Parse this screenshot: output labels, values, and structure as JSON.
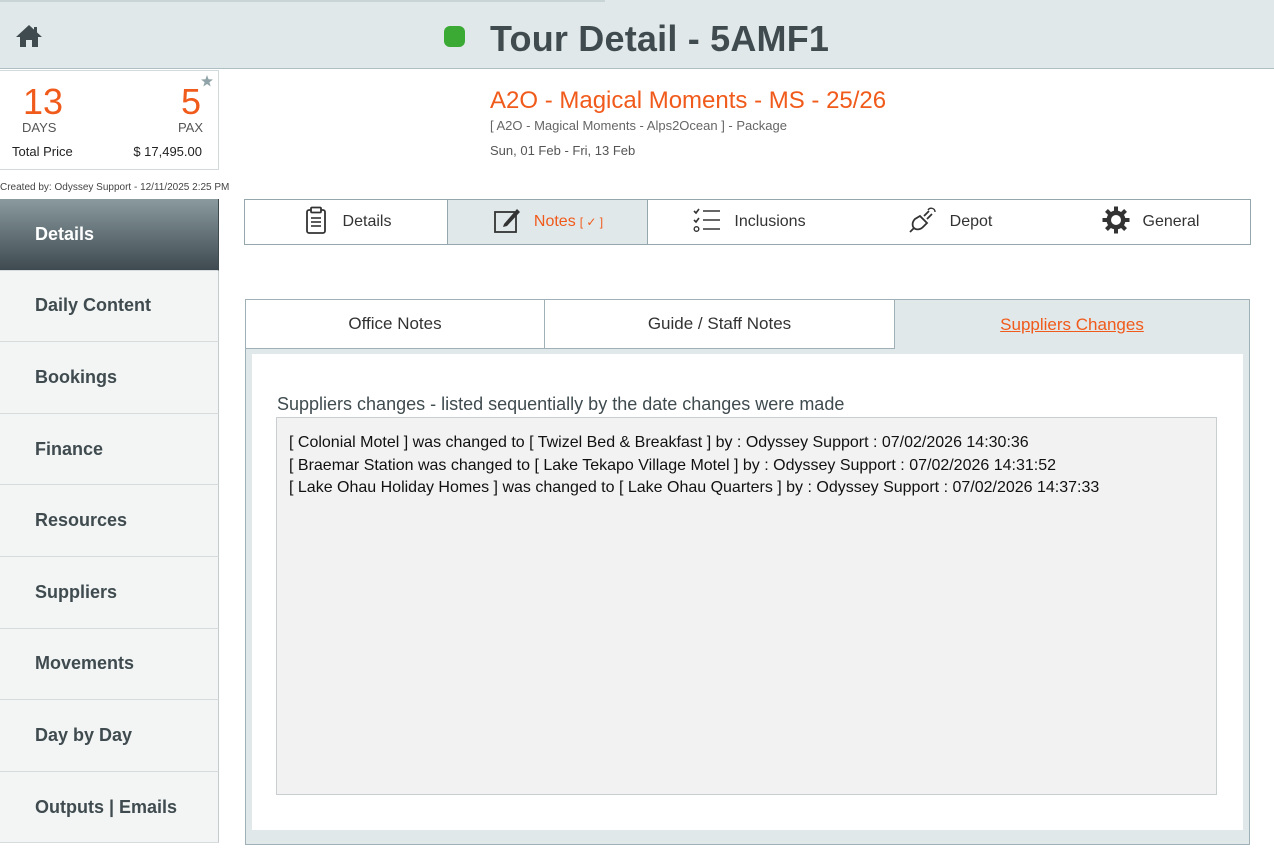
{
  "header": {
    "title": "Tour Detail - 5AMF1",
    "home_icon": "home-icon",
    "status_color": "#3aaa35"
  },
  "summary": {
    "days": "13",
    "days_label": "DAYS",
    "pax": "5",
    "pax_label": "PAX",
    "total_price_label": "Total Price",
    "total_price": "$ 17,495.00"
  },
  "created_by": "Created by: Odyssey Support - 12/11/2025 2:25 PM",
  "tour": {
    "name": "A2O - Magical Moments - MS - 25/26",
    "package": "[ A2O - Magical Moments - Alps2Ocean ] - Package",
    "dates": "Sun, 01 Feb  - Fri, 13 Feb"
  },
  "sidebar": {
    "items": [
      {
        "label": "Details"
      },
      {
        "label": "Daily Content"
      },
      {
        "label": "Bookings"
      },
      {
        "label": "Finance"
      },
      {
        "label": "Resources"
      },
      {
        "label": "Suppliers"
      },
      {
        "label": "Movements"
      },
      {
        "label": "Day by Day"
      },
      {
        "label": "Outputs | Emails"
      }
    ]
  },
  "main_tabs": [
    {
      "label": "Details",
      "icon": "clipboard-icon"
    },
    {
      "label": "Notes",
      "tag": "[ ✓ ]",
      "icon": "edit-icon"
    },
    {
      "label": "Inclusions",
      "icon": "checklist-icon"
    },
    {
      "label": "Depot",
      "icon": "plug-icon"
    },
    {
      "label": "General",
      "icon": "gear-icon"
    }
  ],
  "notes": {
    "sub_tabs": [
      {
        "label": "Office Notes"
      },
      {
        "label": "Guide / Staff Notes"
      },
      {
        "label": "Suppliers Changes"
      }
    ],
    "heading": "Suppliers changes - listed sequentially by the date changes were made",
    "changes": [
      "[ Colonial Motel ] was changed to [ Twizel Bed & Breakfast ] by : Odyssey Support : 07/02/2026 14:30:36",
      "[ Braemar Station was changed to [ Lake Tekapo Village Motel ] by : Odyssey Support : 07/02/2026 14:31:52",
      "[ Lake Ohau Holiday Homes ] was changed to [ Lake Ohau Quarters ] by : Odyssey Support : 07/02/2026 14:37:33"
    ]
  },
  "colors": {
    "accent": "#f05a1a",
    "header_bg": "#e1e8ea",
    "title_text": "#3f4b4f"
  }
}
